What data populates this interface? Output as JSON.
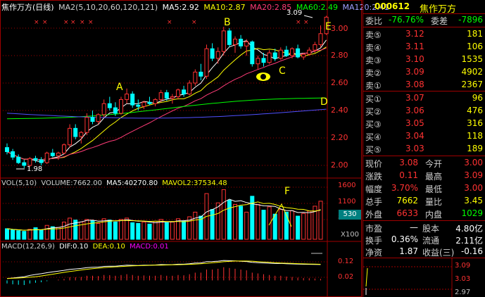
{
  "main_legend": {
    "name": "焦作万方(日线)",
    "ma2": "MA2(5,10,20,60,120,121)",
    "ma5": "MA5:2.92",
    "ma10": "MA10:2.87",
    "ma20": "MA20:2.85",
    "ma60": "MA60:2.49",
    "ma120": "MA120:2.41"
  },
  "colors": {
    "up": "#ff3232",
    "down": "#00ffff",
    "ma5": "#ffffff",
    "ma10": "#ffff00",
    "ma20": "#ff3c78",
    "ma60": "#00ff00",
    "ma120": "#5050ff",
    "grid": "#a00000",
    "axis": "#ff3232"
  },
  "price_axis": [
    "3.00",
    "2.80",
    "2.60",
    "2.40",
    "2.20",
    "2.00"
  ],
  "annotations": {
    "a": "A",
    "b": "B",
    "c": "C",
    "d": "D",
    "e": "E",
    "f": "F",
    "high": "3.09",
    "low": "1.98"
  },
  "vol_legend": {
    "vol": "VOL(5,10)",
    "volume": "VOLUME:7662.00",
    "ma5": "MA5:40270.80",
    "mavol2": "MAVOL2:37534.48"
  },
  "vol_axis": [
    "1600",
    "1100",
    "800"
  ],
  "vol_marker": "530",
  "vol_unit": "X100",
  "macd_legend": {
    "macd": "MACD(12,26,9)",
    "dif": "DIF:0.10",
    "dea": "DEA:0.10",
    "macd_val": "MACD:0.01"
  },
  "macd_axis": [
    "0.12",
    "0.02"
  ],
  "candles": [
    {
      "o": 2.13,
      "h": 2.16,
      "l": 2.08,
      "c": 2.1
    },
    {
      "o": 2.1,
      "h": 2.12,
      "l": 2.04,
      "c": 2.06
    },
    {
      "o": 2.06,
      "h": 2.08,
      "l": 2.01,
      "c": 2.02
    },
    {
      "o": 2.02,
      "h": 2.04,
      "l": 1.98,
      "c": 2.0
    },
    {
      "o": 2.0,
      "h": 2.06,
      "l": 1.99,
      "c": 2.05
    },
    {
      "o": 2.05,
      "h": 2.07,
      "l": 2.02,
      "c": 2.04
    },
    {
      "o": 2.04,
      "h": 2.06,
      "l": 2.0,
      "c": 2.02
    },
    {
      "o": 2.02,
      "h": 2.1,
      "l": 2.01,
      "c": 2.09
    },
    {
      "o": 2.09,
      "h": 2.12,
      "l": 2.06,
      "c": 2.07
    },
    {
      "o": 2.07,
      "h": 2.1,
      "l": 2.04,
      "c": 2.09
    },
    {
      "o": 2.09,
      "h": 2.16,
      "l": 2.08,
      "c": 2.15
    },
    {
      "o": 2.15,
      "h": 2.3,
      "l": 2.13,
      "c": 2.27
    },
    {
      "o": 2.27,
      "h": 2.3,
      "l": 2.19,
      "c": 2.21
    },
    {
      "o": 2.21,
      "h": 2.25,
      "l": 2.16,
      "c": 2.24
    },
    {
      "o": 2.24,
      "h": 2.38,
      "l": 2.22,
      "c": 2.35
    },
    {
      "o": 2.35,
      "h": 2.4,
      "l": 2.3,
      "c": 2.32
    },
    {
      "o": 2.32,
      "h": 2.38,
      "l": 2.3,
      "c": 2.37
    },
    {
      "o": 2.37,
      "h": 2.48,
      "l": 2.35,
      "c": 2.45
    },
    {
      "o": 2.45,
      "h": 2.5,
      "l": 2.4,
      "c": 2.42
    },
    {
      "o": 2.42,
      "h": 2.46,
      "l": 2.36,
      "c": 2.38
    },
    {
      "o": 2.38,
      "h": 2.5,
      "l": 2.37,
      "c": 2.48
    },
    {
      "o": 2.48,
      "h": 2.56,
      "l": 2.45,
      "c": 2.52
    },
    {
      "o": 2.52,
      "h": 2.54,
      "l": 2.42,
      "c": 2.44
    },
    {
      "o": 2.44,
      "h": 2.48,
      "l": 2.4,
      "c": 2.43
    },
    {
      "o": 2.43,
      "h": 2.47,
      "l": 2.41,
      "c": 2.46
    },
    {
      "o": 2.46,
      "h": 2.5,
      "l": 2.44,
      "c": 2.45
    },
    {
      "o": 2.45,
      "h": 2.49,
      "l": 2.43,
      "c": 2.48
    },
    {
      "o": 2.48,
      "h": 2.55,
      "l": 2.46,
      "c": 2.53
    },
    {
      "o": 2.53,
      "h": 2.55,
      "l": 2.47,
      "c": 2.49
    },
    {
      "o": 2.49,
      "h": 2.52,
      "l": 2.45,
      "c": 2.5
    },
    {
      "o": 2.5,
      "h": 2.56,
      "l": 2.48,
      "c": 2.55
    },
    {
      "o": 2.55,
      "h": 2.58,
      "l": 2.5,
      "c": 2.52
    },
    {
      "o": 2.52,
      "h": 2.62,
      "l": 2.51,
      "c": 2.6
    },
    {
      "o": 2.6,
      "h": 2.7,
      "l": 2.58,
      "c": 2.68
    },
    {
      "o": 2.68,
      "h": 2.74,
      "l": 2.62,
      "c": 2.65
    },
    {
      "o": 2.65,
      "h": 2.88,
      "l": 2.63,
      "c": 2.85
    },
    {
      "o": 2.85,
      "h": 2.89,
      "l": 2.76,
      "c": 2.78
    },
    {
      "o": 2.78,
      "h": 2.86,
      "l": 2.74,
      "c": 2.83
    },
    {
      "o": 2.83,
      "h": 3.01,
      "l": 2.8,
      "c": 2.98
    },
    {
      "o": 2.98,
      "h": 3.0,
      "l": 2.86,
      "c": 2.88
    },
    {
      "o": 2.88,
      "h": 2.94,
      "l": 2.82,
      "c": 2.92
    },
    {
      "o": 2.92,
      "h": 2.95,
      "l": 2.85,
      "c": 2.87
    },
    {
      "o": 2.87,
      "h": 2.92,
      "l": 2.8,
      "c": 2.9
    },
    {
      "o": 2.9,
      "h": 2.91,
      "l": 2.72,
      "c": 2.74
    },
    {
      "o": 2.74,
      "h": 2.8,
      "l": 2.7,
      "c": 2.78
    },
    {
      "o": 2.78,
      "h": 2.82,
      "l": 2.72,
      "c": 2.75
    },
    {
      "o": 2.75,
      "h": 2.84,
      "l": 2.74,
      "c": 2.82
    },
    {
      "o": 2.82,
      "h": 2.85,
      "l": 2.76,
      "c": 2.78
    },
    {
      "o": 2.78,
      "h": 2.86,
      "l": 2.77,
      "c": 2.84
    },
    {
      "o": 2.84,
      "h": 2.87,
      "l": 2.79,
      "c": 2.8
    },
    {
      "o": 2.8,
      "h": 2.86,
      "l": 2.78,
      "c": 2.85
    },
    {
      "o": 2.85,
      "h": 2.88,
      "l": 2.78,
      "c": 2.79
    },
    {
      "o": 2.79,
      "h": 2.82,
      "l": 2.77,
      "c": 2.81
    },
    {
      "o": 2.81,
      "h": 2.86,
      "l": 2.8,
      "c": 2.84
    },
    {
      "o": 2.84,
      "h": 2.9,
      "l": 2.82,
      "c": 2.88
    },
    {
      "o": 2.88,
      "h": 3.02,
      "l": 2.86,
      "c": 2.96
    },
    {
      "o": 2.96,
      "h": 3.09,
      "l": 2.95,
      "c": 3.08
    }
  ],
  "volumes": [
    320,
    280,
    260,
    240,
    300,
    350,
    280,
    420,
    380,
    360,
    520,
    640,
    580,
    520,
    600,
    560,
    480,
    620,
    580,
    520,
    600,
    640,
    500,
    480,
    520,
    460,
    540,
    600,
    500,
    520,
    620,
    560,
    680,
    820,
    700,
    1380,
    900,
    1100,
    1500,
    1180,
    1050,
    1000,
    820,
    1300,
    1050,
    880,
    980,
    760,
    900,
    820,
    860,
    700,
    780,
    850,
    1000,
    1150
  ],
  "macd_hist": [
    -0.02,
    -0.025,
    -0.028,
    -0.03,
    -0.02,
    -0.015,
    -0.012,
    -0.005,
    0.0,
    0.005,
    0.01,
    0.02,
    0.02,
    0.022,
    0.03,
    0.03,
    0.028,
    0.035,
    0.034,
    0.03,
    0.035,
    0.04,
    0.035,
    0.03,
    0.032,
    0.03,
    0.03,
    0.035,
    0.03,
    0.03,
    0.035,
    0.033,
    0.04,
    0.05,
    0.05,
    0.07,
    0.07,
    0.075,
    0.085,
    0.08,
    0.075,
    0.07,
    0.065,
    0.05,
    0.045,
    0.04,
    0.035,
    0.03,
    0.03,
    0.025,
    0.022,
    0.018,
    0.015,
    0.014,
    0.012,
    0.01
  ],
  "quote": {
    "name": "焦作万方",
    "code": "000612",
    "webi_label": "委比",
    "webi_val": "-76.76%",
    "weicha_label": "委差",
    "weicha_val": "-7896",
    "asks": [
      {
        "label": "卖⑤",
        "price": "3.12",
        "vol": "181"
      },
      {
        "label": "卖④",
        "price": "3.11",
        "vol": "106"
      },
      {
        "label": "卖③",
        "price": "3.10",
        "vol": "1535"
      },
      {
        "label": "卖②",
        "price": "3.09",
        "vol": "4902"
      },
      {
        "label": "卖①",
        "price": "3.08",
        "vol": "2367"
      }
    ],
    "bids": [
      {
        "label": "买①",
        "price": "3.07",
        "vol": "96"
      },
      {
        "label": "买②",
        "price": "3.06",
        "vol": "476"
      },
      {
        "label": "买③",
        "price": "3.05",
        "vol": "316"
      },
      {
        "label": "买④",
        "price": "3.04",
        "vol": "118"
      },
      {
        "label": "买⑤",
        "price": "3.03",
        "vol": "189"
      }
    ],
    "stats": [
      {
        "l1": "现价",
        "v1": "3.08",
        "l2": "今开",
        "v2": "3.00"
      },
      {
        "l1": "涨跌",
        "v1": "0.11",
        "l2": "最高",
        "v2": "3.09"
      },
      {
        "l1": "幅度",
        "v1": "3.70%",
        "l2": "最低",
        "v2": "3.00"
      },
      {
        "l1": "总手",
        "v1": "7662",
        "l2": "量比",
        "v2": "3.45"
      },
      {
        "l1": "外盘",
        "v1": "6633",
        "l2": "内盘",
        "v2": "1029"
      }
    ],
    "fin": [
      {
        "l1": "市盈",
        "v1": "—",
        "l2": "股本",
        "v2": "4.80亿"
      },
      {
        "l1": "换手",
        "v1": "0.36%",
        "l2": "流通",
        "v2": "2.11亿"
      },
      {
        "l1": "净资",
        "v1": "1.87",
        "l2": "收益(三)",
        "v2": "-0.16"
      }
    ],
    "mini_axis": [
      "3.09",
      "3.03",
      "2.97"
    ]
  }
}
